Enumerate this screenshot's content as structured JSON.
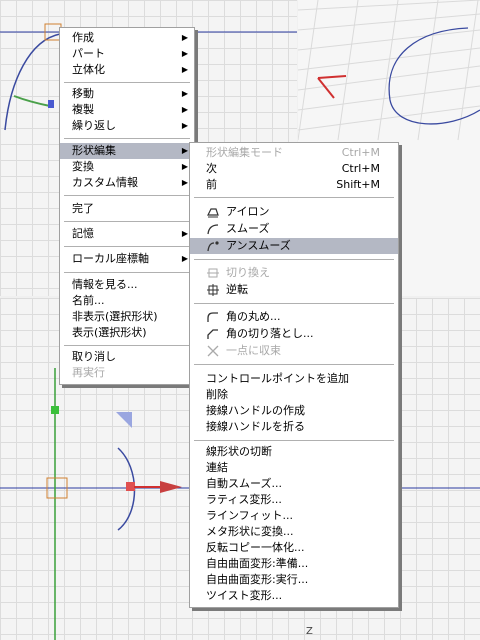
{
  "context_menu": {
    "items": [
      {
        "label": "作成",
        "submenu": true
      },
      {
        "label": "パート",
        "submenu": true
      },
      {
        "label": "立体化",
        "submenu": true
      },
      {
        "label": "移動",
        "submenu": true
      },
      {
        "label": "複製",
        "submenu": true
      },
      {
        "label": "繰り返し",
        "submenu": true
      },
      {
        "label": "形状編集",
        "submenu": true,
        "highlighted": true
      },
      {
        "label": "変換",
        "submenu": true
      },
      {
        "label": "カスタム情報",
        "submenu": true
      },
      {
        "label": "完了"
      },
      {
        "label": "記憶",
        "submenu": true
      },
      {
        "label": "ローカル座標軸",
        "submenu": true
      },
      {
        "label": "情報を見る..."
      },
      {
        "label": "名前..."
      },
      {
        "label": "非表示(選択形状)"
      },
      {
        "label": "表示(選択形状)"
      },
      {
        "label": "取り消し"
      },
      {
        "label": "再実行",
        "disabled": true
      }
    ]
  },
  "submenu": {
    "items": [
      {
        "label": "形状編集モード",
        "shortcut": "Ctrl+M",
        "disabled": true
      },
      {
        "label": "次",
        "shortcut": "Ctrl+M"
      },
      {
        "label": "前",
        "shortcut": "Shift+M"
      },
      {
        "label": "アイロン",
        "icon": "iron-icon"
      },
      {
        "label": "スムーズ",
        "icon": "smooth-icon"
      },
      {
        "label": "アンスムーズ",
        "icon": "unsmooth-icon",
        "highlighted": true
      },
      {
        "label": "切り換え",
        "icon": "switch-icon",
        "disabled": true
      },
      {
        "label": "逆転",
        "icon": "reverse-icon"
      },
      {
        "label": "角の丸め...",
        "icon": "round-corner-icon"
      },
      {
        "label": "角の切り落とし...",
        "icon": "chamfer-icon"
      },
      {
        "label": "一点に収束",
        "icon": "converge-icon",
        "disabled": true
      },
      {
        "label": "コントロールポイントを追加"
      },
      {
        "label": "削除"
      },
      {
        "label": "接線ハンドルの作成"
      },
      {
        "label": "接線ハンドルを折る"
      },
      {
        "label": "線形状の切断"
      },
      {
        "label": "連結"
      },
      {
        "label": "自動スムーズ..."
      },
      {
        "label": "ラティス変形..."
      },
      {
        "label": "ラインフィット..."
      },
      {
        "label": "メタ形状に変換..."
      },
      {
        "label": "反転コピー一体化..."
      },
      {
        "label": "自由曲面変形:準備..."
      },
      {
        "label": "自由曲面変形:実行..."
      },
      {
        "label": "ツイスト変形..."
      }
    ]
  },
  "viewport": {
    "axis_label": "Z"
  },
  "colors": {
    "menu_bg": "#ffffff",
    "highlight": "#b4b8c4",
    "disabled_text": "#a8a8a8",
    "curve": "#3a4aa0",
    "axis_red": "#d03030"
  }
}
